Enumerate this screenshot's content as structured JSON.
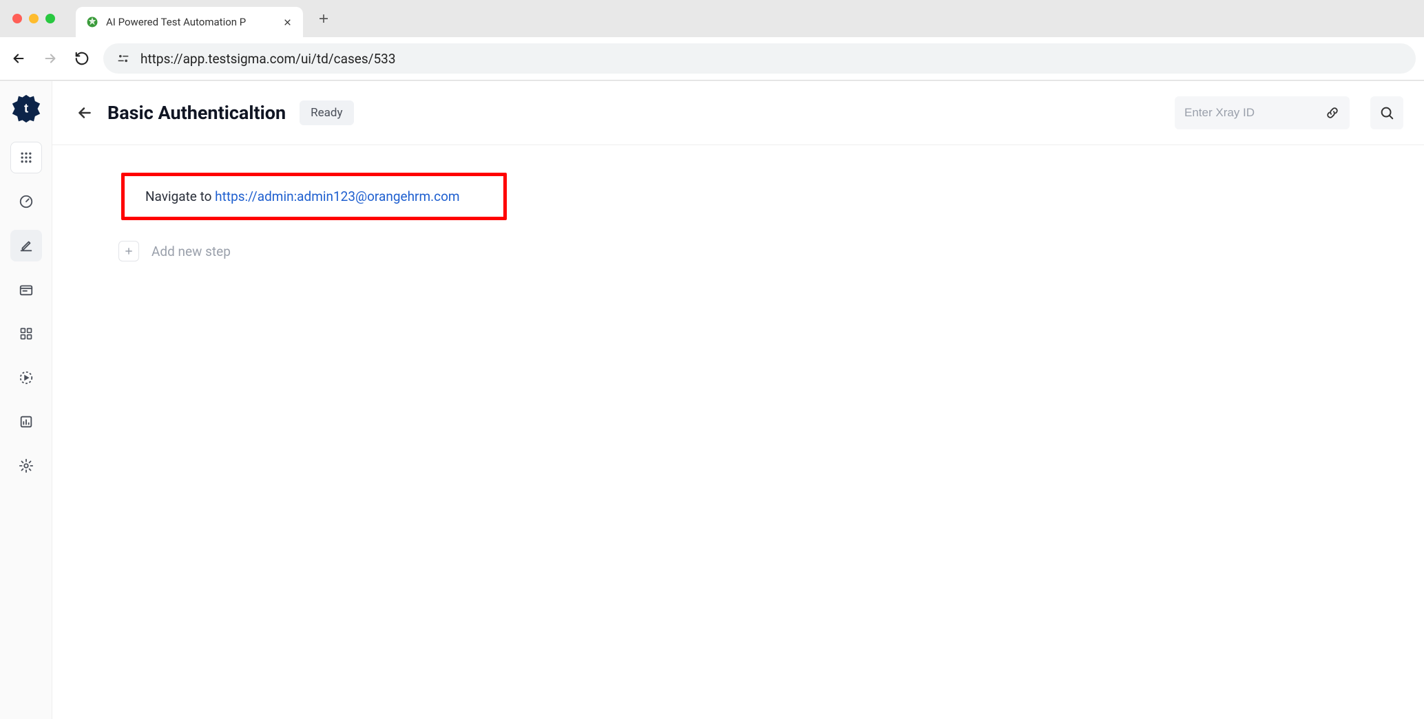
{
  "browser": {
    "tab_title": "AI Powered Test Automation P",
    "url": "https://app.testsigma.com/ui/td/cases/533"
  },
  "header": {
    "title": "Basic Authenticaltion",
    "status": "Ready",
    "xray_placeholder": "Enter Xray ID"
  },
  "step": {
    "prefix": "Navigate to ",
    "url": "https://admin:admin123@orangehrm.com"
  },
  "add_step_label": "Add new step"
}
